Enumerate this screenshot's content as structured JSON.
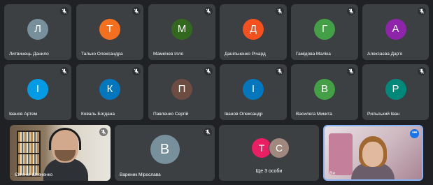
{
  "grid_row1": [
    {
      "name": "Литвинець Данило",
      "initial": "Л",
      "color": "#78909c"
    },
    {
      "name": "Талько Олександра",
      "initial": "Т",
      "color": "#f4701e"
    },
    {
      "name": "Мамкічев Ілля",
      "initial": "М",
      "color": "#33691e"
    },
    {
      "name": "Данільченко Річард",
      "initial": "Д",
      "color": "#f4511e"
    },
    {
      "name": "Гамідова Маліка",
      "initial": "Г",
      "color": "#43a047"
    },
    {
      "name": "Алексаєва Дар'я",
      "initial": "А",
      "color": "#8e24aa"
    }
  ],
  "grid_row2": [
    {
      "name": "Іванов Артем",
      "initial": "І",
      "color": "#039be5"
    },
    {
      "name": "Коваль Богдана",
      "initial": "К",
      "color": "#0277bd"
    },
    {
      "name": "Павленко Сергій",
      "initial": "П",
      "color": "#6d4c41"
    },
    {
      "name": "Іванов Олександр",
      "initial": "І",
      "color": "#0277bd"
    },
    {
      "name": "Василега Микита",
      "initial": "В",
      "color": "#43a047"
    },
    {
      "name": "Рильський Іван",
      "initial": "Р",
      "color": "#00897b"
    }
  ],
  "video_participant": {
    "name": "Євгенія Шевченко"
  },
  "large_tile": {
    "name": "Вареник Мірослава",
    "initial": "В",
    "color": "#78909c"
  },
  "others_tile": {
    "label": "Ще 3 особи",
    "avatars": [
      {
        "initial": "Т",
        "color": "#e91e63"
      },
      {
        "initial": "С",
        "color": "#a1887f"
      }
    ]
  },
  "self_tile": {
    "name": "Ви",
    "more_label": "•••"
  },
  "icons": {
    "mic_off": "mic-off-icon",
    "more": "more-options-icon"
  }
}
